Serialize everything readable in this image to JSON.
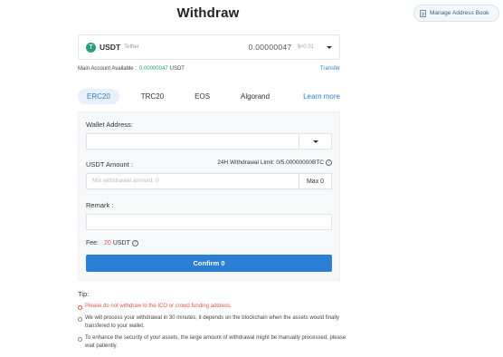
{
  "page": {
    "title": "Withdraw"
  },
  "address_book": {
    "label": "Manage Address Book"
  },
  "coin": {
    "icon_letter": "T",
    "symbol": "USDT",
    "name": "Tether",
    "balance": "0.00000047",
    "usd_value": "$<0.01"
  },
  "balance_row": {
    "label": "Main Account Available :",
    "amount": "0.00000047",
    "unit": "USDT",
    "transfer_label": "Transfer"
  },
  "networks": {
    "tabs": [
      "ERC20",
      "TRC20",
      "EOS",
      "Algorand"
    ],
    "active": "ERC20",
    "learn_more": "Learn more"
  },
  "form": {
    "wallet_address_label": "Wallet Address:",
    "usdt_amount_label": "USDT Amount :",
    "withdrawal_limit": "24H Withdrawal Limit: 0/5.00000000BTC",
    "amount_placeholder": "Min withdrawal amount: 0",
    "max_label": "Max 0",
    "remark_label": "Remark :",
    "fee_label": "Fee:",
    "fee_value": "20",
    "fee_unit": "USDT",
    "confirm_label": "Confirm 0"
  },
  "tips": {
    "title": "Tip:",
    "items": [
      "Please do not withdraw to the ICO or crowd funding address.",
      "We will process your withdrawal in 30 minutes, it depends on the blockchain when the assets would finally transfered to your wallet.",
      "To enhance the security of your assets, the large amount of withdrawal might be manually processed, please wait patiently."
    ]
  },
  "colors": {
    "accent": "#2a7ed4",
    "warning": "#e0554d",
    "tether": "#26a17b"
  }
}
